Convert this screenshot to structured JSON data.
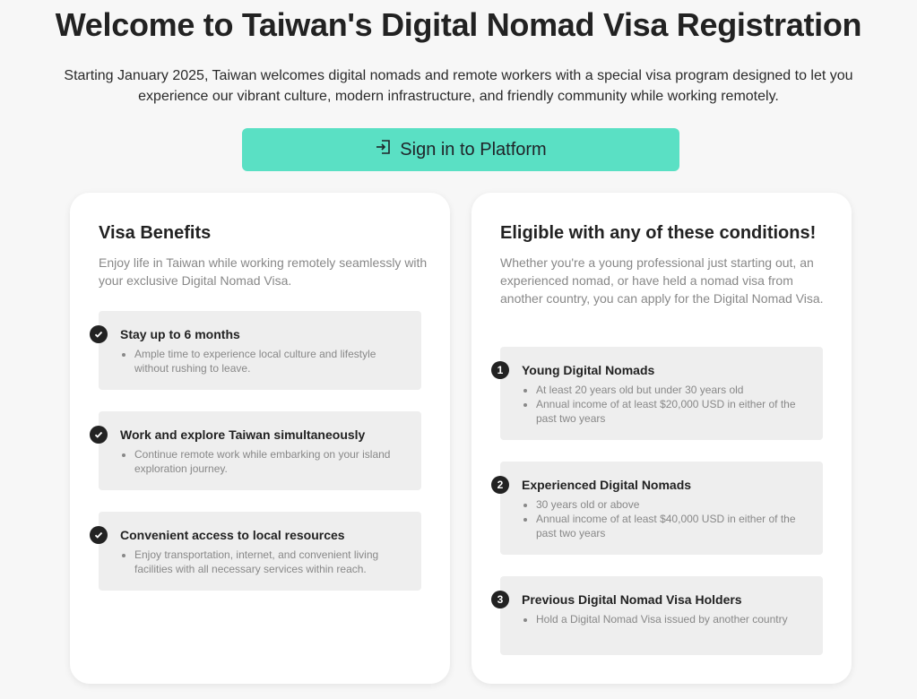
{
  "header": {
    "title": "Welcome to Taiwan's Digital Nomad Visa Registration",
    "intro": "Starting January 2025, Taiwan welcomes digital nomads and remote workers with a special visa program designed to let you experience our vibrant culture, modern infrastructure, and friendly community while working remotely.",
    "signin_label": "Sign in to Platform"
  },
  "benefits": {
    "title": "Visa Benefits",
    "description": "Enjoy life in Taiwan while working remotely seamlessly with your exclusive Digital Nomad Visa.",
    "items": [
      {
        "title": "Stay up to 6 months",
        "bullets": [
          "Ample time to experience local culture and lifestyle without rushing to leave."
        ]
      },
      {
        "title": "Work and explore Taiwan simultaneously",
        "bullets": [
          "Continue remote work while embarking on your island exploration journey."
        ]
      },
      {
        "title": "Convenient access to local resources",
        "bullets": [
          "Enjoy transportation, internet, and convenient living facilities with all necessary services within reach."
        ]
      }
    ]
  },
  "eligibility": {
    "title": "Eligible with any of these conditions!",
    "description": "Whether you're a young professional just starting out, an experienced nomad, or have held a nomad visa from another country, you can apply for the Digital Nomad Visa.",
    "items": [
      {
        "number": "1",
        "title": "Young Digital Nomads",
        "bullets": [
          "At least 20 years old but under 30 years old",
          "Annual income of at least $20,000 USD in either of the past two years"
        ]
      },
      {
        "number": "2",
        "title": "Experienced Digital Nomads",
        "bullets": [
          "30 years old or above",
          "Annual income of at least $40,000 USD in either of the past two years"
        ]
      },
      {
        "number": "3",
        "title": "Previous Digital Nomad Visa Holders",
        "bullets": [
          "Hold a Digital Nomad Visa issued by another country"
        ]
      }
    ]
  },
  "colors": {
    "accent": "#5ae0c4",
    "background": "#f7f7f7",
    "marker": "#222222"
  }
}
